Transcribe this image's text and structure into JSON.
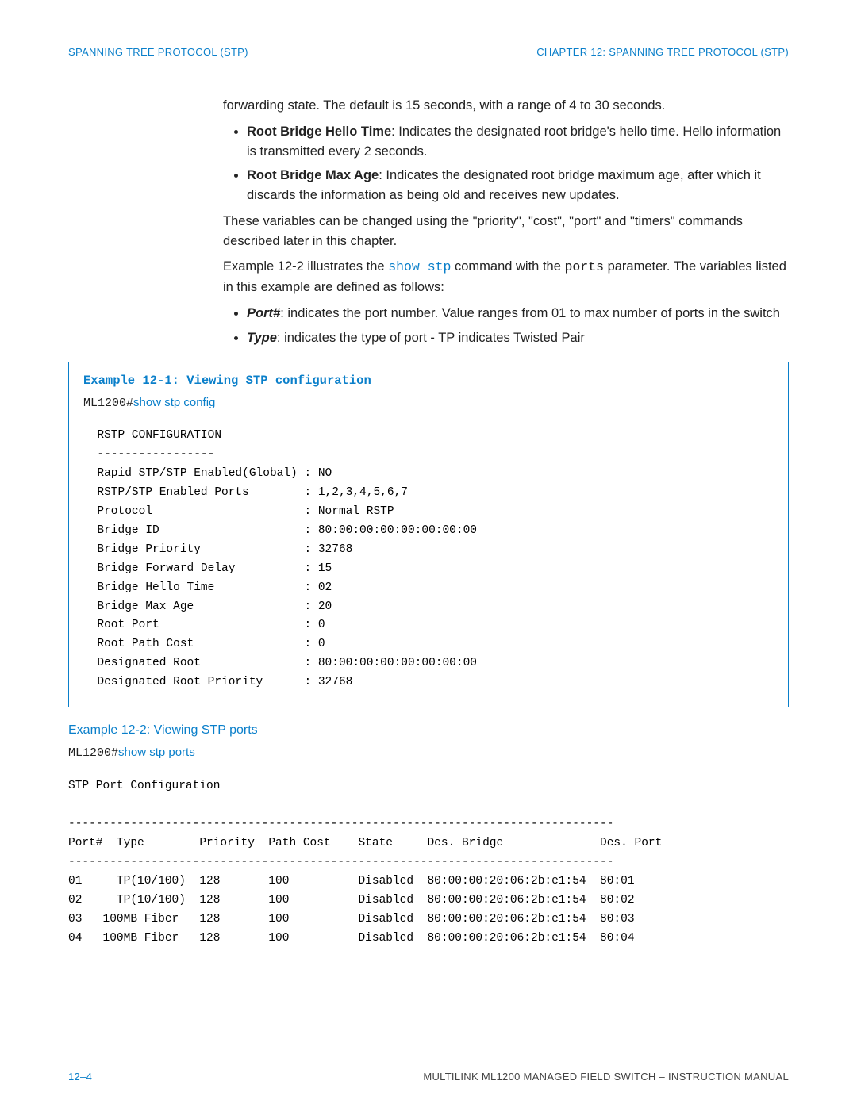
{
  "header": {
    "left": "SPANNING TREE PROTOCOL (STP)",
    "right": "CHAPTER 12: SPANNING TREE PROTOCOL (STP)"
  },
  "intro": {
    "line1": "forwarding state. The default is 15 seconds, with a range of 4 to 30 seconds.",
    "hello_term": "Root Bridge Hello Time",
    "hello_text": ": Indicates the designated root bridge's hello time. Hello information is transmitted every 2 seconds.",
    "maxage_term": "Root Bridge Max Age",
    "maxage_text": ": Indicates the designated root bridge maximum age, after which it discards the information as being old and receives new updates."
  },
  "para1": "These variables can be changed using the \"priority\", \"cost\", \"port\" and \"timers\" commands described later in this chapter.",
  "para2a": "Example 12-2 illustrates the ",
  "para2_cmd": "show stp",
  "para2b": " command with the ",
  "para2_ports": "ports",
  "para2c": " parameter. The variables listed in this example are defined as follows:",
  "bul2": {
    "port_term": "Port#",
    "port_text": ": indicates the port number. Value ranges from 01 to max number of ports in the switch",
    "type_term": "Type",
    "type_text": ": indicates the type of port - TP indicates Twisted Pair"
  },
  "example1": {
    "title": "Example 12-1: Viewing STP configuration",
    "prompt": "ML1200#",
    "cmd": "show stp config",
    "output": "  RSTP CONFIGURATION\n  -----------------\n  Rapid STP/STP Enabled(Global) : NO\n  RSTP/STP Enabled Ports        : 1,2,3,4,5,6,7\n  Protocol                      : Normal RSTP\n  Bridge ID                     : 80:00:00:00:00:00:00:00\n  Bridge Priority               : 32768\n  Bridge Forward Delay          : 15\n  Bridge Hello Time             : 02\n  Bridge Max Age                : 20\n  Root Port                     : 0\n  Root Path Cost                : 0\n  Designated Root               : 80:00:00:00:00:00:00:00\n  Designated Root Priority      : 32768"
  },
  "example2": {
    "title": "Example 12-2: Viewing STP ports",
    "prompt": "ML1200#",
    "cmd": "show stp ports",
    "output": "STP Port Configuration\n\n-------------------------------------------------------------------------------\nPort#  Type        Priority  Path Cost    State     Des. Bridge              Des. Port\n-------------------------------------------------------------------------------\n01     TP(10/100)  128       100          Disabled  80:00:00:20:06:2b:e1:54  80:01\n02     TP(10/100)  128       100          Disabled  80:00:00:20:06:2b:e1:54  80:02\n03   100MB Fiber   128       100          Disabled  80:00:00:20:06:2b:e1:54  80:03\n04   100MB Fiber   128       100          Disabled  80:00:00:20:06:2b:e1:54  80:04"
  },
  "footer": {
    "left": "12–4",
    "right": "MULTILINK ML1200 MANAGED FIELD SWITCH – INSTRUCTION MANUAL"
  }
}
